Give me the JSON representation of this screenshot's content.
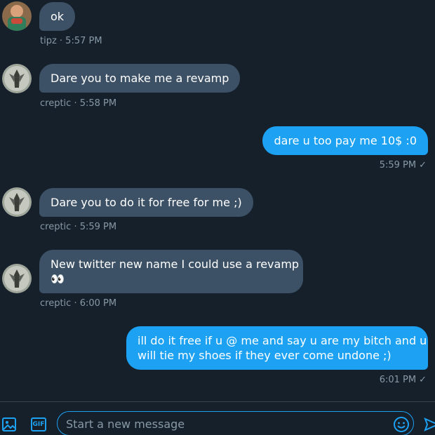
{
  "messages": [
    {
      "direction": "in",
      "text": "ok",
      "meta": "tipz · 5:57 PM",
      "avatar": "boy-avatar"
    },
    {
      "direction": "in",
      "text": "Dare you to make me a revamp",
      "meta": "creptic · 5:58 PM",
      "avatar": "creptic-avatar"
    },
    {
      "direction": "out",
      "text": "dare u too pay me 10$ :0",
      "meta": "5:59 PM",
      "status": "sent-check-icon"
    },
    {
      "direction": "in",
      "text": "Dare you to do it for free for me ;)",
      "meta": "creptic · 5:59 PM",
      "avatar": "creptic-avatar"
    },
    {
      "direction": "in",
      "text_line1": "New twitter new name I could use a revamp",
      "text_line2": "👀",
      "meta": "creptic · 6:00 PM",
      "avatar": "creptic-avatar"
    },
    {
      "direction": "out",
      "text_line1": "ill do it free if u @ me and say u are my bitch and u",
      "text_line2": "will tie my shoes if they ever come undone ;)",
      "meta": "6:01 PM",
      "status": "sent-check-icon"
    }
  ],
  "check_glyph": "✓",
  "composer": {
    "placeholder": "Start a new message",
    "media_icon": "image-icon",
    "gif_label": "GIF",
    "emoji_icon": "emoji-icon",
    "send_icon": "send-icon"
  },
  "colors": {
    "background": "#15202b",
    "incoming_bubble": "#3d5166",
    "outgoing_bubble": "#1da1f2",
    "meta_text": "#8899a6",
    "accent": "#1da1f2"
  }
}
